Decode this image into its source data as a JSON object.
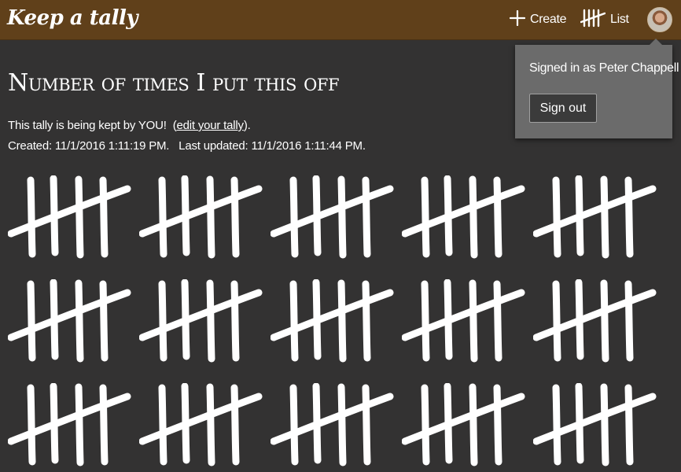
{
  "brand": "Keep a tally",
  "nav": {
    "create_label": "Create",
    "list_label": "List"
  },
  "account": {
    "signed_in_text": "Signed in as Peter Chappell",
    "sign_out_label": "Sign out"
  },
  "tally": {
    "title": "Number of times I put this off",
    "owner_text": "This tally is being kept by YOU!",
    "edit_link_open": "(",
    "edit_link_label": "edit your tally",
    "edit_link_close": ").",
    "created_label": "Created:",
    "created_value": "11/1/2016 1:11:19 PM.",
    "updated_label": "Last updated:",
    "updated_value": "11/1/2016 1:11:44 PM.",
    "groups_of_five_visible": 15
  },
  "colors": {
    "topbar": "#60401a",
    "background": "#333232",
    "popover": "#6b6b6b",
    "marks": "#ffffff"
  },
  "icons": {
    "create": "plus-icon",
    "list": "tally-icon",
    "avatar": "user-avatar"
  }
}
